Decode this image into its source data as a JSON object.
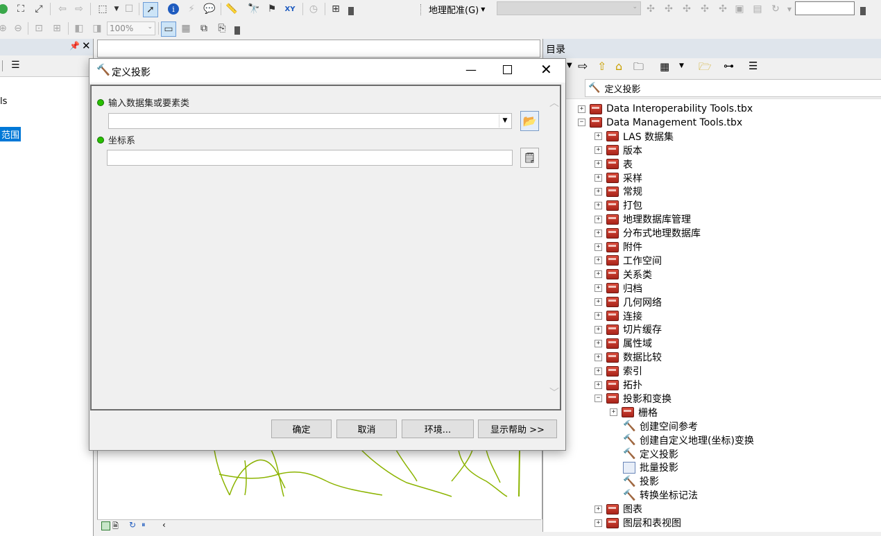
{
  "toolbar": {
    "georef_menu": "地理配准(G)",
    "zoom_value": "100%",
    "georef_layer_value": "",
    "scale_value": ""
  },
  "left_panel": {
    "item_partial": "ls",
    "item_selected": "范围"
  },
  "catalog": {
    "title": "目录",
    "location_label": ":",
    "location_value": "定义投影",
    "tree": [
      {
        "label": "Data Interoperability Tools.tbx",
        "level": 0,
        "expander": "+",
        "icon": "toolbox-icon"
      },
      {
        "label": "Data Management Tools.tbx",
        "level": 0,
        "expander": "-",
        "icon": "toolbox-icon"
      },
      {
        "label": "LAS 数据集",
        "level": 1,
        "expander": "+",
        "icon": "toolset-icon"
      },
      {
        "label": "版本",
        "level": 1,
        "expander": "+",
        "icon": "toolset-icon"
      },
      {
        "label": "表",
        "level": 1,
        "expander": "+",
        "icon": "toolset-icon"
      },
      {
        "label": "采样",
        "level": 1,
        "expander": "+",
        "icon": "toolset-icon"
      },
      {
        "label": "常规",
        "level": 1,
        "expander": "+",
        "icon": "toolset-icon"
      },
      {
        "label": "打包",
        "level": 1,
        "expander": "+",
        "icon": "toolset-icon"
      },
      {
        "label": "地理数据库管理",
        "level": 1,
        "expander": "+",
        "icon": "toolset-icon"
      },
      {
        "label": "分布式地理数据库",
        "level": 1,
        "expander": "+",
        "icon": "toolset-icon"
      },
      {
        "label": "附件",
        "level": 1,
        "expander": "+",
        "icon": "toolset-icon"
      },
      {
        "label": "工作空间",
        "level": 1,
        "expander": "+",
        "icon": "toolset-icon"
      },
      {
        "label": "关系类",
        "level": 1,
        "expander": "+",
        "icon": "toolset-icon"
      },
      {
        "label": "归档",
        "level": 1,
        "expander": "+",
        "icon": "toolset-icon"
      },
      {
        "label": "几何网络",
        "level": 1,
        "expander": "+",
        "icon": "toolset-icon"
      },
      {
        "label": "连接",
        "level": 1,
        "expander": "+",
        "icon": "toolset-icon"
      },
      {
        "label": "切片缓存",
        "level": 1,
        "expander": "+",
        "icon": "toolset-icon"
      },
      {
        "label": "属性域",
        "level": 1,
        "expander": "+",
        "icon": "toolset-icon"
      },
      {
        "label": "数据比较",
        "level": 1,
        "expander": "+",
        "icon": "toolset-icon"
      },
      {
        "label": "索引",
        "level": 1,
        "expander": "+",
        "icon": "toolset-icon"
      },
      {
        "label": "拓扑",
        "level": 1,
        "expander": "+",
        "icon": "toolset-icon"
      },
      {
        "label": "投影和变换",
        "level": 1,
        "expander": "-",
        "icon": "toolset-icon"
      },
      {
        "label": "栅格",
        "level": 2,
        "expander": "+",
        "icon": "toolset-icon"
      },
      {
        "label": "创建空间参考",
        "level": 2,
        "expander": "",
        "icon": "hammer-icon"
      },
      {
        "label": "创建自定义地理(坐标)变换",
        "level": 2,
        "expander": "",
        "icon": "hammer-icon"
      },
      {
        "label": "定义投影",
        "level": 2,
        "expander": "",
        "icon": "hammer-icon"
      },
      {
        "label": "批量投影",
        "level": 2,
        "expander": "",
        "icon": "script-icon"
      },
      {
        "label": "投影",
        "level": 2,
        "expander": "",
        "icon": "hammer-icon"
      },
      {
        "label": "转换坐标记法",
        "level": 2,
        "expander": "",
        "icon": "hammer-icon"
      },
      {
        "label": "图表",
        "level": 1,
        "expander": "+",
        "icon": "toolset-icon"
      },
      {
        "label": "图层和表视图",
        "level": 1,
        "expander": "+",
        "icon": "toolset-icon"
      }
    ]
  },
  "dialog": {
    "title": "定义投影",
    "param1_label": "输入数据集或要素类",
    "param1_value": "",
    "param2_label": "坐标系",
    "param2_value": "",
    "buttons": {
      "ok": "确定",
      "cancel": "取消",
      "env": "环境...",
      "help": "显示帮助 >>"
    }
  },
  "colors": {
    "selection": "#0078d7",
    "map_lines": "#8cb400",
    "required_dot": "#29c000"
  }
}
